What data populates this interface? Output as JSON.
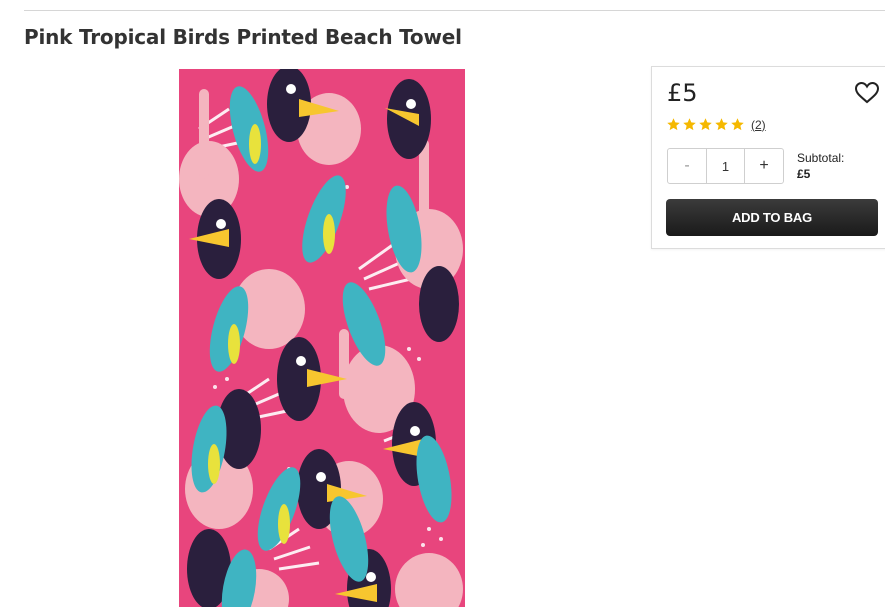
{
  "product": {
    "title": "Pink Tropical Birds Printed Beach Towel",
    "image_alt": "Pink tropical birds towel with toucans, parrots and flamingos"
  },
  "purchase": {
    "price": "£5",
    "rating": 5,
    "review_count": "(2)",
    "quantity": "1",
    "minus_label": "-",
    "plus_label": "+",
    "subtotal_label": "Subtotal:",
    "subtotal_value": "£5",
    "add_to_bag_label": "ADD TO BAG"
  },
  "icons": {
    "wishlist": "heart-outline-icon",
    "star": "star-icon"
  },
  "colors": {
    "towel_pink": "#e8457d",
    "star_gold": "#f5b800",
    "button_dark": "#222222"
  }
}
